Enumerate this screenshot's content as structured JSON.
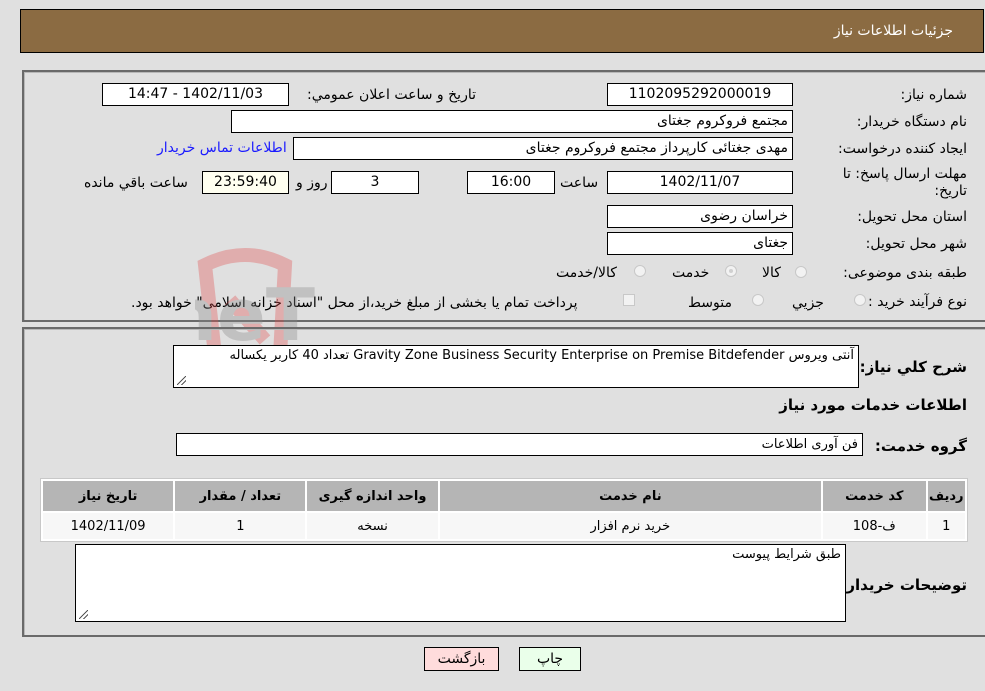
{
  "header": {
    "title": "جزئیات اطلاعات نیاز"
  },
  "form": {
    "need_number": {
      "label": "شماره نیاز:",
      "value": "1102095292000019"
    },
    "announce_datetime": {
      "label": "تاریخ و ساعت اعلان عمومي:",
      "value": "1402/11/03 - 14:47"
    },
    "buyer_org": {
      "label": "نام دستگاه خریدار:",
      "value": "مجتمع فروکروم جغتای"
    },
    "requester": {
      "label": "ایجاد کننده درخواست:",
      "value": "مهدی جغتائی کارپرداز مجتمع فروکروم جغتای"
    },
    "buyer_contact_link": "اطلاعات تماس خریدار",
    "deadline": {
      "label": "مهلت ارسال پاسخ: تا تاریخ:",
      "date": "1402/11/07",
      "time_label": "ساعت",
      "time": "16:00",
      "days": "3",
      "days_label": "روز و",
      "remaining": "23:59:40",
      "remaining_label": "ساعت باقي مانده"
    },
    "province": {
      "label": "استان محل تحویل:",
      "value": "خراسان رضوی"
    },
    "city": {
      "label": "شهر محل تحویل:",
      "value": "جغتای"
    },
    "category": {
      "label": "طبقه بندی موضوعی:",
      "options": [
        "کالا",
        "خدمت",
        "کالا/خدمت"
      ],
      "selected": "خدمت"
    },
    "purchase_type": {
      "label": "نوع فرآیند خرید :",
      "options": [
        "جزیي",
        "متوسط"
      ],
      "selected": "جزیي",
      "treasury_note": "پرداخت تمام یا بخشی از مبلغ خرید،از محل \"اسناد خزانه اسلامی\" خواهد بود."
    }
  },
  "description": {
    "label": "شرح كلي نياز:",
    "value": "آنتی ویروس Gravity Zone Business Security Enterprise on Premise Bitdefender  تعداد 40 کاربر یکساله"
  },
  "services": {
    "section_title": "اطلاعات خدمات مورد نیاز",
    "group_label": "گروه خدمت:",
    "group_value": "فن آوری اطلاعات",
    "table": {
      "headers": [
        "ردیف",
        "کد خدمت",
        "نام خدمت",
        "واحد اندازه گیری",
        "تعداد / مقدار",
        "تاریخ نیاز"
      ],
      "rows": [
        [
          "1",
          "ف-108",
          "خرید نرم افزار",
          "نسخه",
          "1",
          "1402/11/09"
        ]
      ]
    }
  },
  "buyer_notes": {
    "label": "توضیحات خریدار:",
    "value": "طبق شرایط پیوست"
  },
  "buttons": {
    "print": "چاپ",
    "back": "بازگشت"
  },
  "watermark": {
    "text": "AriaTender.neT"
  },
  "colors": {
    "header_bg": "#8b6b42",
    "print_btn": "#eaffea",
    "back_btn": "#ffdcdc",
    "link": "#1a1aff"
  }
}
